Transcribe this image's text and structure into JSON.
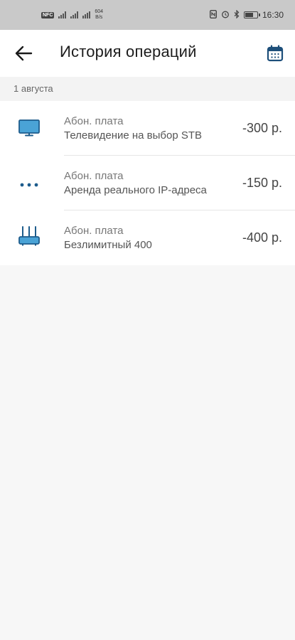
{
  "status_bar": {
    "network_chip": "NFC",
    "speed_value": "604",
    "speed_unit": "B/s",
    "time": "16:30",
    "icons": [
      "nfc-icon",
      "alarm-icon",
      "bluetooth-icon",
      "battery-icon"
    ]
  },
  "header": {
    "back_icon": "arrow-left-icon",
    "title": "История операций",
    "calendar_icon": "calendar-icon"
  },
  "date_group": "1 августа",
  "operations": [
    {
      "type": "Абон. плата",
      "name": "Телевидение на выбор STB",
      "amount": "-300 р.",
      "icon": "tv-icon"
    },
    {
      "type": "Абон. плата",
      "name": "Аренда реального IP-адреса",
      "amount": "-150 р.",
      "icon": "more-dots-icon"
    },
    {
      "type": "Абон. плата",
      "name": "Безлимитный 400",
      "amount": "-400 р.",
      "icon": "router-icon"
    }
  ],
  "colors": {
    "accent": "#1d5c8c",
    "icon_blue": "#4aa3d6",
    "status_bar_bg": "#c9c9c9"
  }
}
